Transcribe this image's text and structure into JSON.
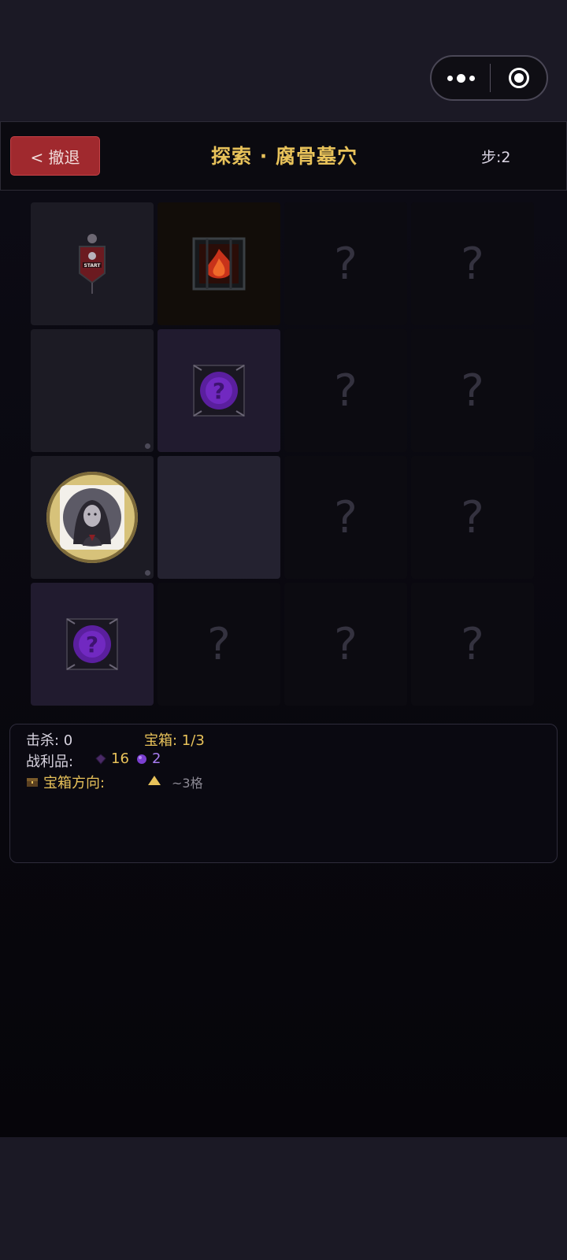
{
  "header": {
    "retreat_label": "< 撤退",
    "title": "探索 · 腐骨墓穴",
    "steps_label": "步:",
    "steps_value": "2"
  },
  "grid": {
    "rows": 4,
    "cols": 4,
    "cells": [
      {
        "row": 0,
        "col": 0,
        "state": "visited",
        "content": "start-banner"
      },
      {
        "row": 0,
        "col": 1,
        "state": "revealed",
        "content": "fire-trap"
      },
      {
        "row": 0,
        "col": 2,
        "state": "unknown",
        "content": "?"
      },
      {
        "row": 0,
        "col": 3,
        "state": "unknown",
        "content": "?"
      },
      {
        "row": 1,
        "col": 0,
        "state": "visited",
        "content": "empty"
      },
      {
        "row": 1,
        "col": 1,
        "state": "revealed",
        "content": "mystery-event"
      },
      {
        "row": 1,
        "col": 2,
        "state": "unknown",
        "content": "?"
      },
      {
        "row": 1,
        "col": 3,
        "state": "unknown",
        "content": "?"
      },
      {
        "row": 2,
        "col": 0,
        "state": "current",
        "content": "player"
      },
      {
        "row": 2,
        "col": 1,
        "state": "revealed",
        "content": "empty"
      },
      {
        "row": 2,
        "col": 2,
        "state": "unknown",
        "content": "?"
      },
      {
        "row": 2,
        "col": 3,
        "state": "unknown",
        "content": "?"
      },
      {
        "row": 3,
        "col": 0,
        "state": "revealed",
        "content": "mystery-event"
      },
      {
        "row": 3,
        "col": 1,
        "state": "unknown",
        "content": "?"
      },
      {
        "row": 3,
        "col": 2,
        "state": "unknown",
        "content": "?"
      },
      {
        "row": 3,
        "col": 3,
        "state": "unknown",
        "content": "?"
      }
    ]
  },
  "stats": {
    "kills_label": "击杀: ",
    "kills_value": "0",
    "chests_label": "宝箱: ",
    "chests_value": "1/3",
    "loot_label": "战利品:",
    "loot_items": [
      {
        "icon": "dark-gem-icon",
        "count": "16",
        "color": "#e8c25a"
      },
      {
        "icon": "purple-gem-icon",
        "count": "2",
        "color": "#a77cf0"
      }
    ],
    "chest_direction_label": "宝箱方向:",
    "chest_direction_icon": "up-arrow-icon",
    "chest_distance": "~3格"
  },
  "colors": {
    "accent_gold": "#e8c25a",
    "retreat_red": "#a0292e",
    "purple": "#a77cf0"
  }
}
